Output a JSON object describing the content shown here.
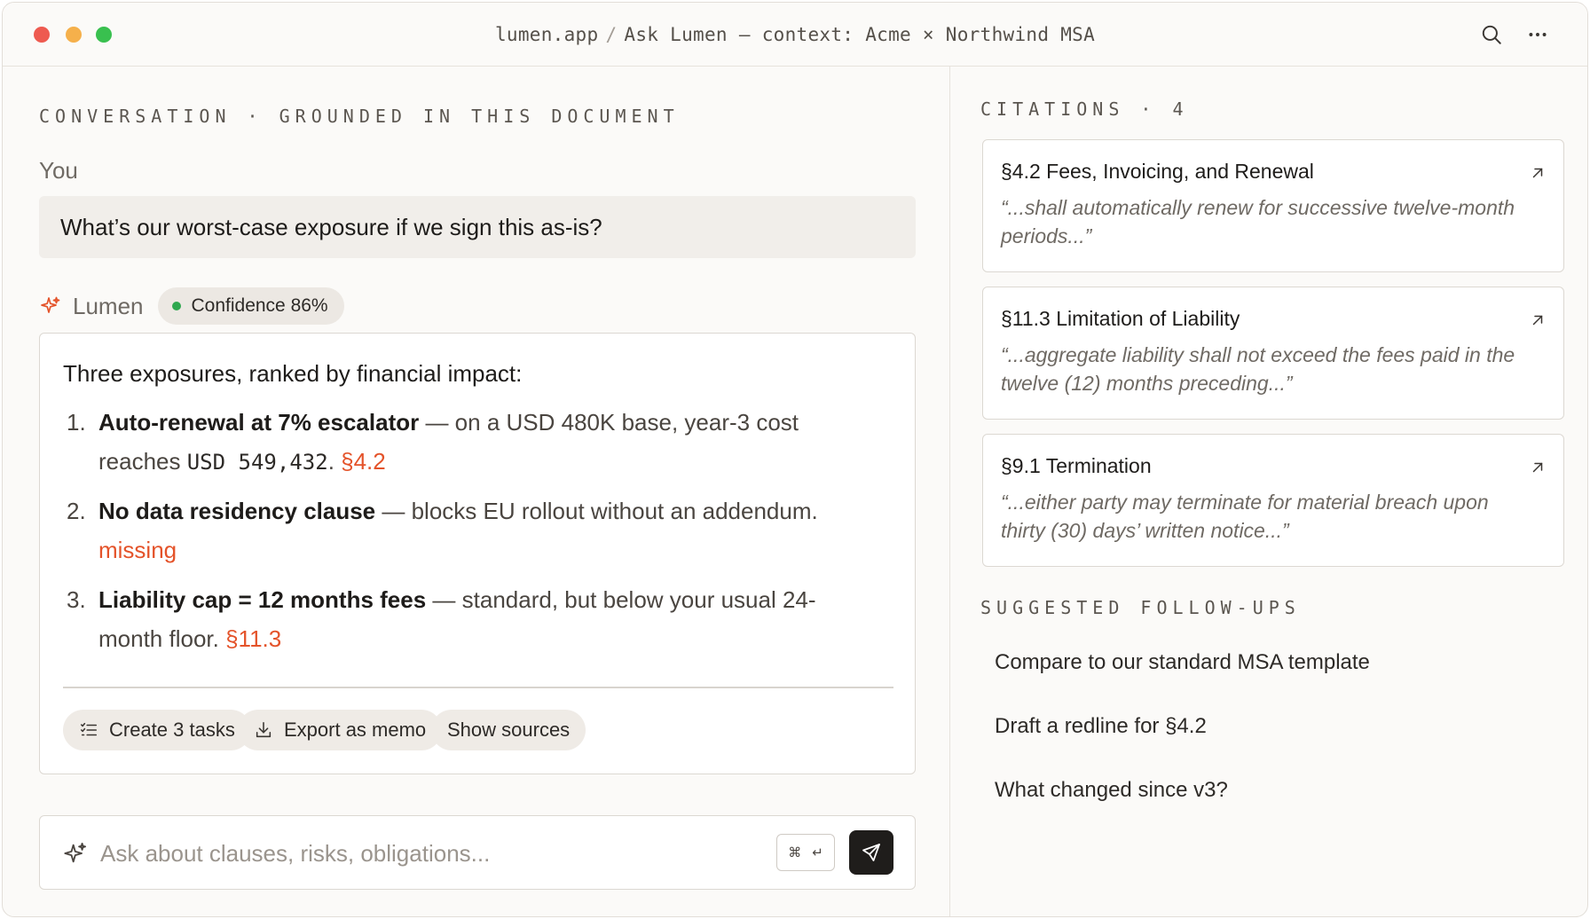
{
  "window": {
    "breadcrumb": [
      "lumen.app",
      "Ask Lumen — context: Acme × Northwind MSA"
    ],
    "separator": "/",
    "icons": [
      "search-icon",
      "more-icon"
    ]
  },
  "conversation": {
    "eyebrow": "CONVERSATION · GROUNDED IN THIS DOCUMENT",
    "user_label": "You",
    "question": "What’s our worst-case exposure if we sign this as-is?",
    "assistant_label": "Lumen",
    "confidence": "Confidence 86%",
    "confidence_color": "#2fa84f",
    "answer": {
      "intro": "Three exposures, ranked by financial impact:",
      "items": [
        {
          "num": "1.",
          "title": "Auto-renewal at 7% escalator",
          "body": " — on a USD 480K base, year-3 cost reaches ",
          "mono": "USD 549,432",
          "tail": ". ",
          "cite": "§4.2"
        },
        {
          "num": "2.",
          "title": "No data residency clause",
          "body": " — blocks EU rollout without an addendum.",
          "cite": "missing"
        },
        {
          "num": "3.",
          "title": "Liability cap = 12 months fees",
          "body": " — standard, but below your usual 24-month floor. ",
          "cite": "§11.3"
        }
      ],
      "actions": [
        "Create 3 tasks",
        "Export as memo",
        "Show sources"
      ]
    },
    "composer": {
      "placeholder": "Ask about clauses, risks, obligations...",
      "shortcut": [
        "⌘",
        "↵"
      ]
    }
  },
  "sidebar": {
    "citations_label": "CITATIONS · 4",
    "citations": [
      {
        "title": "§4.2 Fees, Invoicing, and Renewal",
        "quote": "“...shall automatically renew for successive twelve-month periods...”"
      },
      {
        "title": "§11.3 Limitation of Liability",
        "quote": "“...aggregate liability shall not exceed the fees paid in the twelve (12) months preceding...”"
      },
      {
        "title": "§9.1 Termination",
        "quote": "“...either party may terminate for material breach upon thirty (30) days’ written notice...”"
      }
    ],
    "followups_label": "SUGGESTED FOLLOW-UPS",
    "followups": [
      "Compare to our standard MSA template",
      "Draft a redline for §4.2",
      "What changed since v3?"
    ]
  },
  "colors": {
    "accent": "#e4532a",
    "send_button": "#1f1d1b"
  }
}
